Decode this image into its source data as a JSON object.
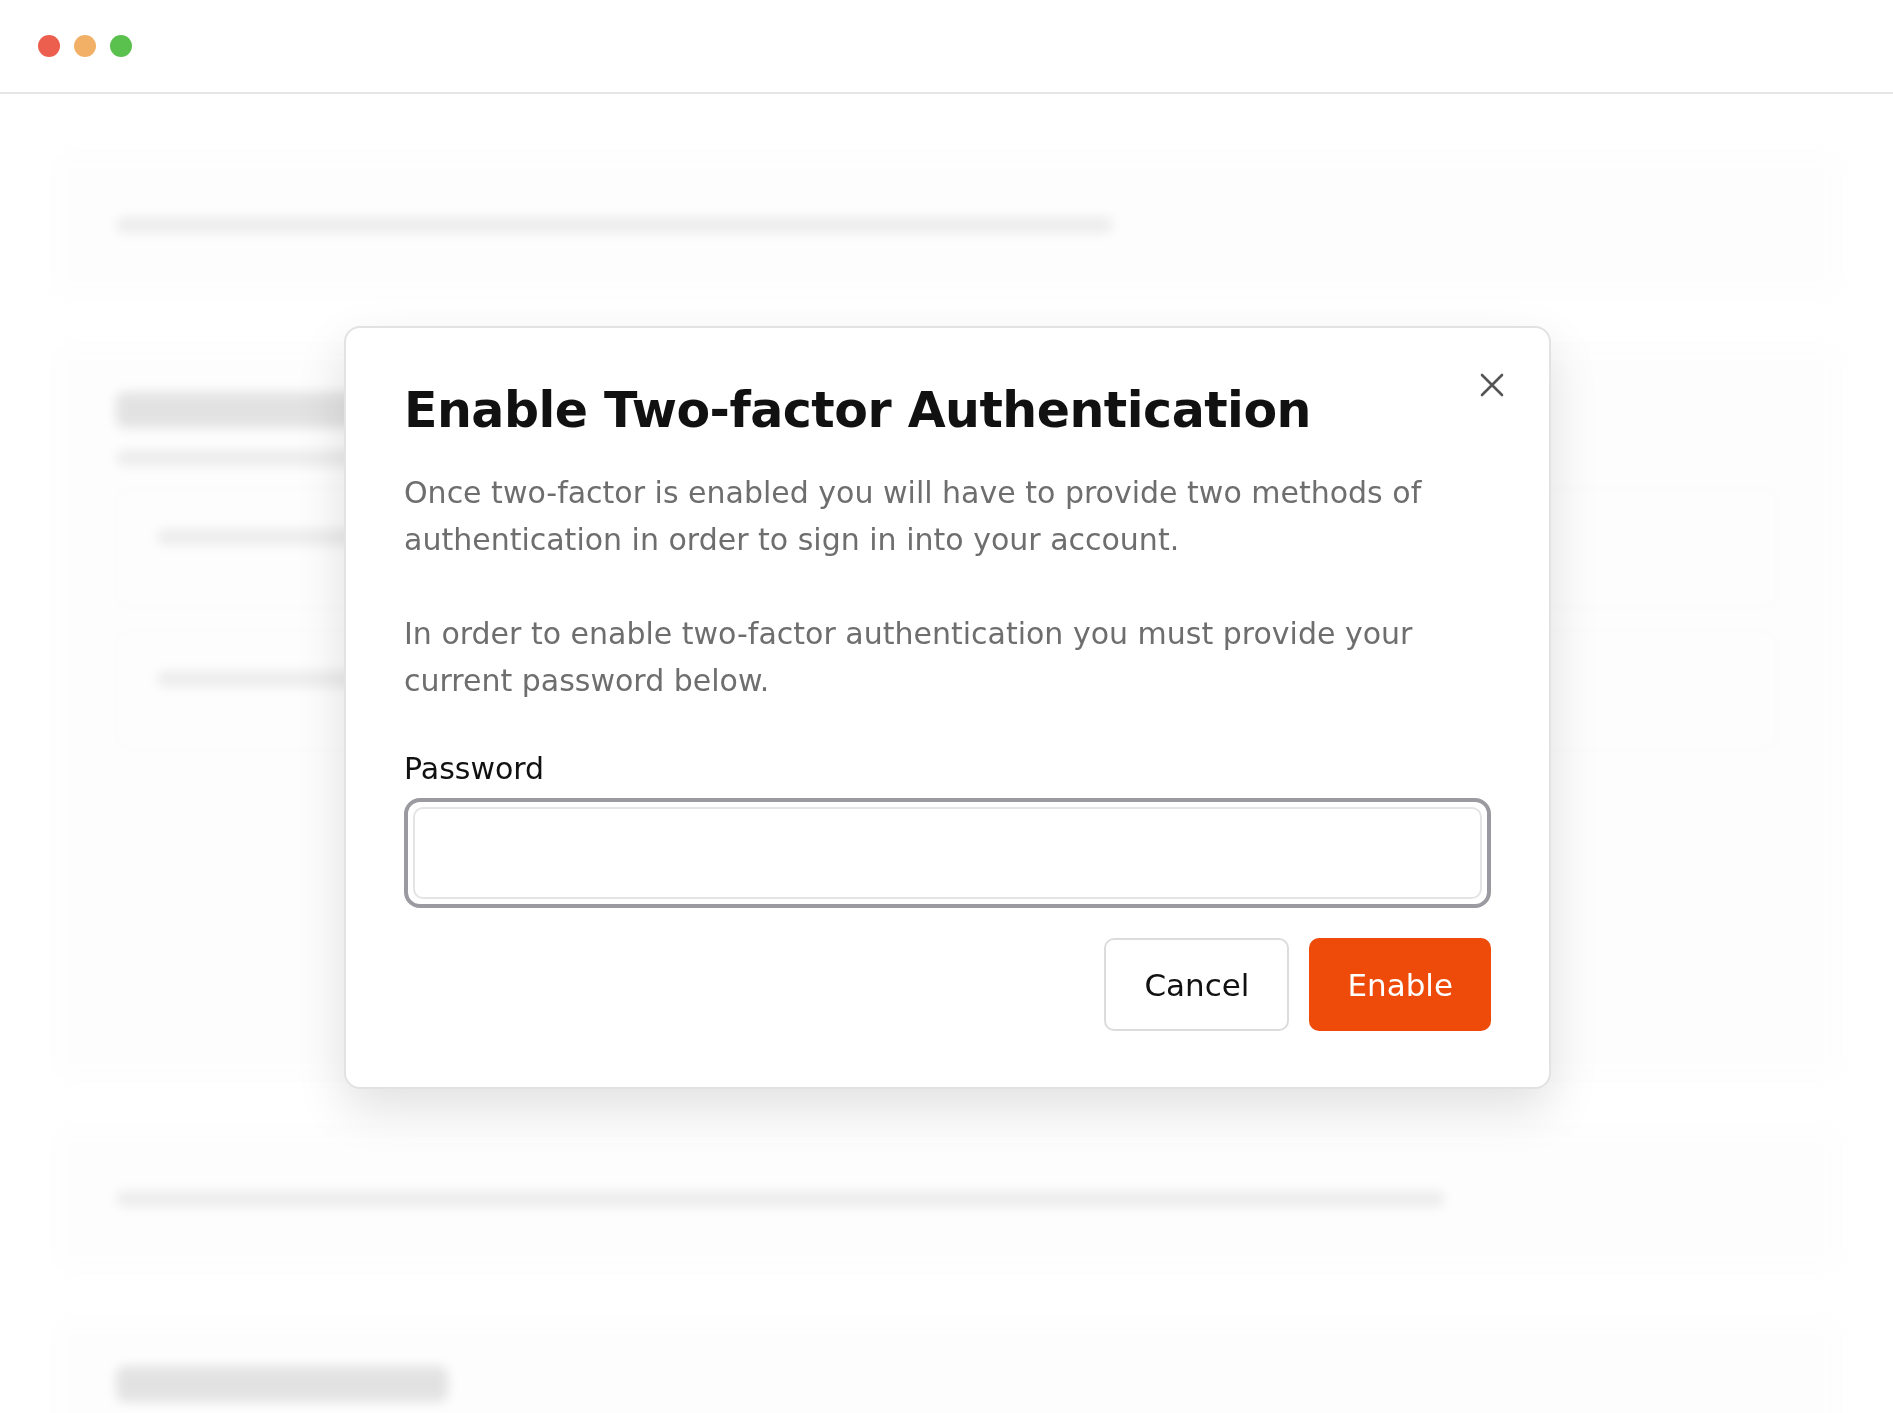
{
  "dialog": {
    "title": "Enable Two-factor Authentication",
    "paragraphs": [
      "Once two-factor is enabled you will have to provide two methods of authentication in order to sign in into your account.",
      "In order to enable two-factor authentication you must provide your current password below."
    ],
    "field": {
      "label": "Password"
    },
    "buttons": [
      {
        "label": "Cancel",
        "kind": "secondary"
      },
      {
        "label": "Enable",
        "kind": "primary"
      }
    ]
  }
}
